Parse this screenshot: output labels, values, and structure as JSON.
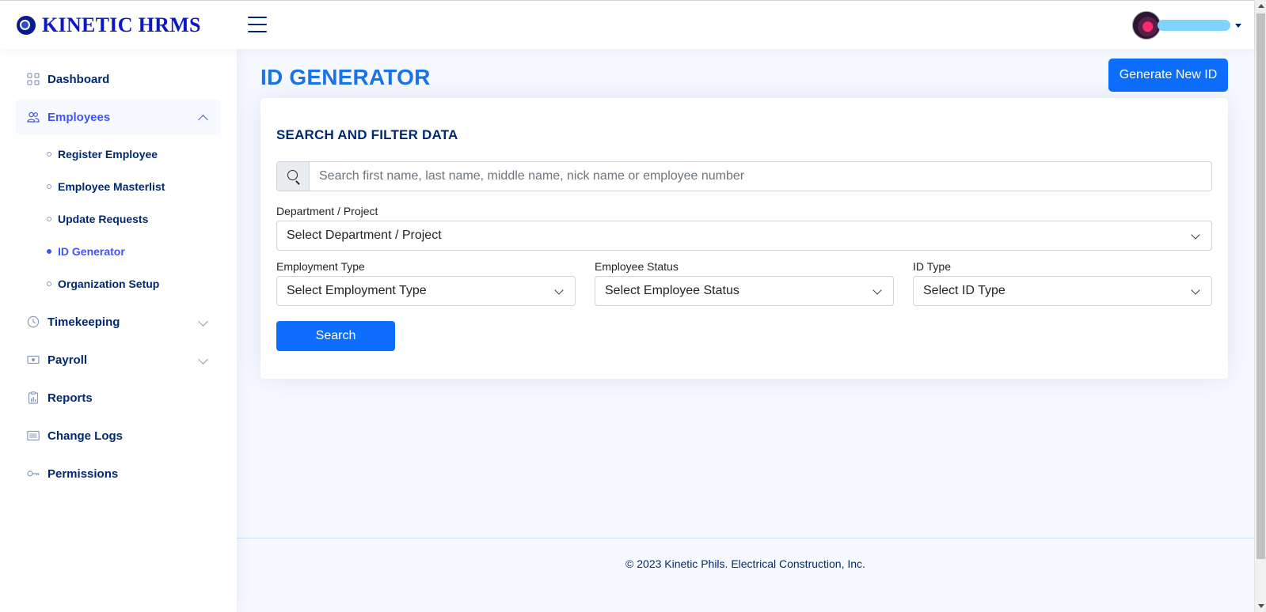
{
  "app": {
    "title": "KINETIC HRMS"
  },
  "header": {
    "menu_icon": "hamburger-icon",
    "profile_icon": "avatar"
  },
  "sidebar": {
    "items": [
      {
        "label": "Dashboard",
        "icon": "grid-icon"
      },
      {
        "label": "Employees",
        "icon": "people-icon",
        "expanded": true
      },
      {
        "label": "Timekeeping",
        "icon": "clock-icon"
      },
      {
        "label": "Payroll",
        "icon": "cash-icon"
      },
      {
        "label": "Reports",
        "icon": "clipboard-data-icon"
      },
      {
        "label": "Change Logs",
        "icon": "card-list-icon"
      },
      {
        "label": "Permissions",
        "icon": "key-icon"
      }
    ],
    "employees_sub": [
      {
        "label": "Register Employee"
      },
      {
        "label": "Employee Masterlist"
      },
      {
        "label": "Update Requests"
      },
      {
        "label": "ID Generator",
        "active": true
      },
      {
        "label": "Organization Setup"
      }
    ]
  },
  "main": {
    "page_title": "ID GENERATOR",
    "generate_button": "Generate New ID",
    "card": {
      "title": "SEARCH AND FILTER DATA",
      "search_placeholder": "Search first name, last name, middle name, nick name or employee number",
      "department_label": "Department / Project",
      "department_value": "Select Department / Project",
      "employment_type_label": "Employment Type",
      "employment_type_value": "Select Employment Type",
      "employee_status_label": "Employee Status",
      "employee_status_value": "Select Employee Status",
      "id_type_label": "ID Type",
      "id_type_value": "Select ID Type",
      "search_button": "Search"
    }
  },
  "footer": {
    "text": "© 2023 Kinetic Phils. Electrical Construction, Inc."
  },
  "colors": {
    "primary": "#0d6efd",
    "title_blue": "#1a73e8",
    "navy": "#012970",
    "active_nav": "#4154f1",
    "page_bg": "#f6f9ff"
  }
}
